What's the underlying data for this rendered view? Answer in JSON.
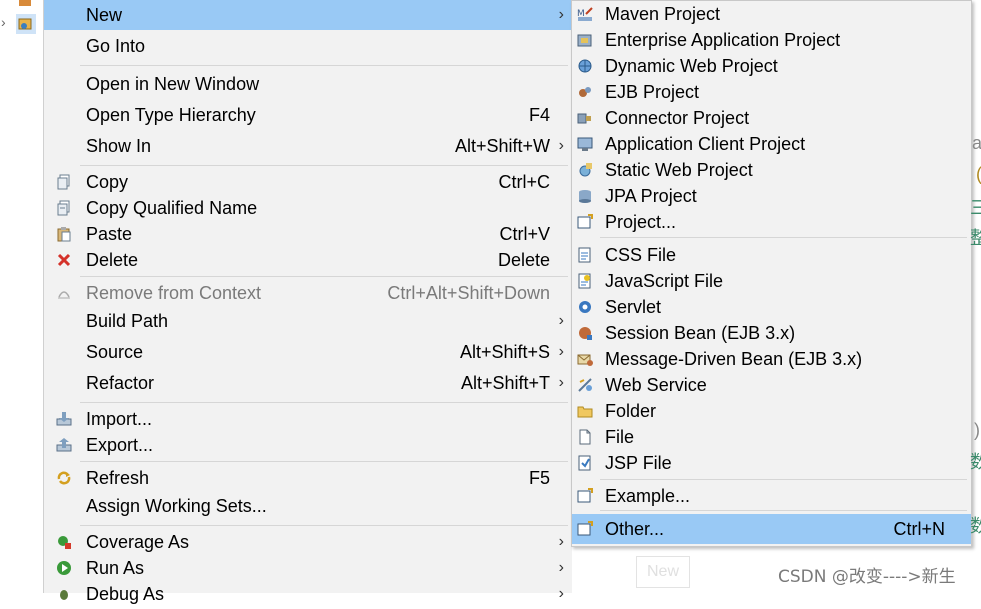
{
  "context_menu": {
    "items": [
      {
        "label": "New",
        "accel": "",
        "submenu": true
      },
      {
        "label": "Go Into",
        "accel": ""
      },
      {
        "label": "Open in New Window",
        "accel": ""
      },
      {
        "label": "Open Type Hierarchy",
        "accel": "F4"
      },
      {
        "label": "Show In",
        "accel": "Alt+Shift+W",
        "submenu": true
      },
      {
        "label": "Copy",
        "accel": "Ctrl+C",
        "icon": "copy-icon"
      },
      {
        "label": "Copy Qualified Name",
        "accel": "",
        "icon": "copy-qualified-icon"
      },
      {
        "label": "Paste",
        "accel": "Ctrl+V",
        "icon": "paste-icon"
      },
      {
        "label": "Delete",
        "accel": "Delete",
        "icon": "delete-icon"
      },
      {
        "label": "Remove from Context",
        "accel": "Ctrl+Alt+Shift+Down",
        "disabled": true,
        "icon": "remove-context-icon"
      },
      {
        "label": "Build Path",
        "accel": "",
        "submenu": true
      },
      {
        "label": "Source",
        "accel": "Alt+Shift+S",
        "submenu": true
      },
      {
        "label": "Refactor",
        "accel": "Alt+Shift+T",
        "submenu": true
      },
      {
        "label": "Import...",
        "accel": "",
        "icon": "import-icon"
      },
      {
        "label": "Export...",
        "accel": "",
        "icon": "export-icon"
      },
      {
        "label": "Refresh",
        "accel": "F5",
        "icon": "refresh-icon"
      },
      {
        "label": "Assign Working Sets...",
        "accel": ""
      },
      {
        "label": "Coverage As",
        "accel": "",
        "submenu": true,
        "icon": "coverage-icon"
      },
      {
        "label": "Run As",
        "accel": "",
        "submenu": true,
        "icon": "run-icon"
      },
      {
        "label": "Debug As",
        "accel": "",
        "submenu": true,
        "icon": "debug-icon"
      }
    ]
  },
  "new_submenu": {
    "items": [
      {
        "label": "Maven Project",
        "icon": "maven-icon"
      },
      {
        "label": "Enterprise Application Project",
        "icon": "enterprise-app-icon"
      },
      {
        "label": "Dynamic Web Project",
        "icon": "dynamic-web-icon"
      },
      {
        "label": "EJB Project",
        "icon": "ejb-icon"
      },
      {
        "label": "Connector Project",
        "icon": "connector-icon"
      },
      {
        "label": "Application Client Project",
        "icon": "app-client-icon"
      },
      {
        "label": "Static Web Project",
        "icon": "static-web-icon"
      },
      {
        "label": "JPA Project",
        "icon": "jpa-icon"
      },
      {
        "label": "Project...",
        "icon": "project-icon"
      },
      {
        "label": "CSS File",
        "icon": "css-file-icon"
      },
      {
        "label": "JavaScript File",
        "icon": "javascript-file-icon"
      },
      {
        "label": "Servlet",
        "icon": "servlet-icon"
      },
      {
        "label": "Session Bean (EJB 3.x)",
        "icon": "session-bean-icon"
      },
      {
        "label": "Message-Driven Bean (EJB 3.x)",
        "icon": "message-bean-icon"
      },
      {
        "label": "Web Service",
        "icon": "web-service-icon"
      },
      {
        "label": "Folder",
        "icon": "folder-icon"
      },
      {
        "label": "File",
        "icon": "file-icon"
      },
      {
        "label": "JSP File",
        "icon": "jsp-file-icon"
      },
      {
        "label": "Example...",
        "icon": "example-icon"
      },
      {
        "label": "Other...",
        "accel": "Ctrl+N",
        "icon": "other-icon"
      }
    ]
  },
  "background": {
    "ghost_button": "New",
    "watermark": "CSDN @改变---->新生",
    "edge_glyphs": [
      "a",
      "(",
      "三",
      "整",
      ")",
      "数",
      "数"
    ]
  },
  "colors": {
    "highlight": "#99c9f5",
    "menu_bg": "#f2f2f2",
    "disabled_text": "#7a7a7a"
  }
}
